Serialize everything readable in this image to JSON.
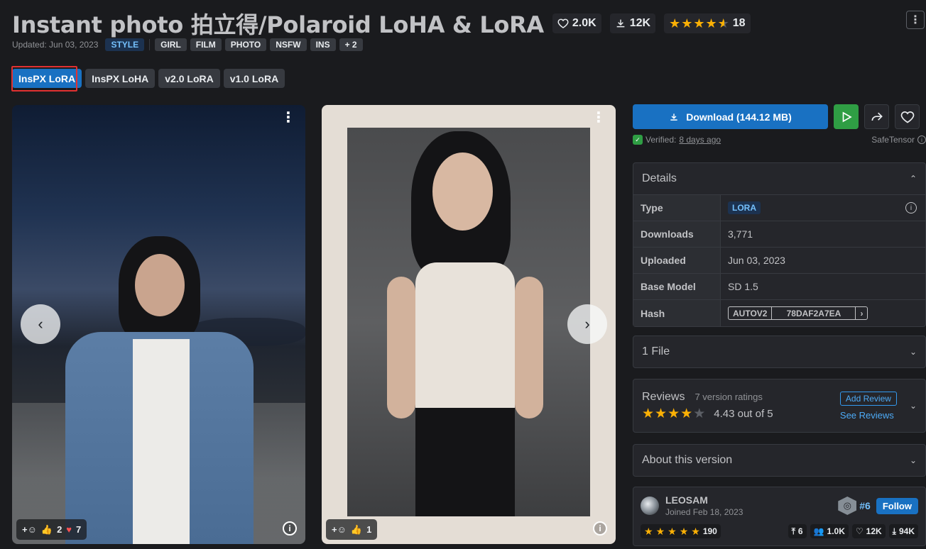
{
  "model": {
    "title": "Instant photo 拍立得/Polaroid LoHA & LoRA",
    "likes": "2.0K",
    "downloads": "12K",
    "rating_count": "18",
    "updated": "Updated: Jun 03, 2023",
    "tags": [
      "STYLE",
      "GIRL",
      "FILM",
      "PHOTO",
      "NSFW",
      "INS",
      "+ 2"
    ]
  },
  "versions": [
    "InsPX LoRA",
    "InsPX LoHA",
    "v2.0 LoRA",
    "v1.0 LoRA"
  ],
  "gallery": {
    "photo1": {
      "thumbs": "2",
      "hearts": "7"
    },
    "photo2": {
      "thumbs": "1"
    }
  },
  "download": {
    "label": "Download (144.12 MB)",
    "verified_label": "Verified:",
    "verified_time": "8 days ago",
    "format": "SafeTensor"
  },
  "details": {
    "title": "Details",
    "rows": [
      {
        "label": "Type",
        "value": "LORA"
      },
      {
        "label": "Downloads",
        "value": "3,771"
      },
      {
        "label": "Uploaded",
        "value": "Jun 03, 2023"
      },
      {
        "label": "Base Model",
        "value": "SD 1.5"
      },
      {
        "label": "Hash",
        "hash_type": "AUTOV2",
        "hash_value": "78DAF2A7EA"
      }
    ]
  },
  "files": {
    "title": "1 File"
  },
  "reviews": {
    "title": "Reviews",
    "count": "7 version ratings",
    "score": "4.43 out of 5",
    "add": "Add Review",
    "see": "See Reviews"
  },
  "about": {
    "title": "About this version"
  },
  "creator": {
    "name": "LEOSAM",
    "joined": "Joined Feb 18, 2023",
    "rank": "#6",
    "follow": "Follow",
    "rating_count": "190",
    "uploads": "6",
    "followers": "1.0K",
    "likes": "12K",
    "downloads": "94K"
  },
  "colors": {
    "accent": "#1971c2",
    "star": "#fab005",
    "green": "#2f9e44",
    "highlight": "#e03131"
  }
}
